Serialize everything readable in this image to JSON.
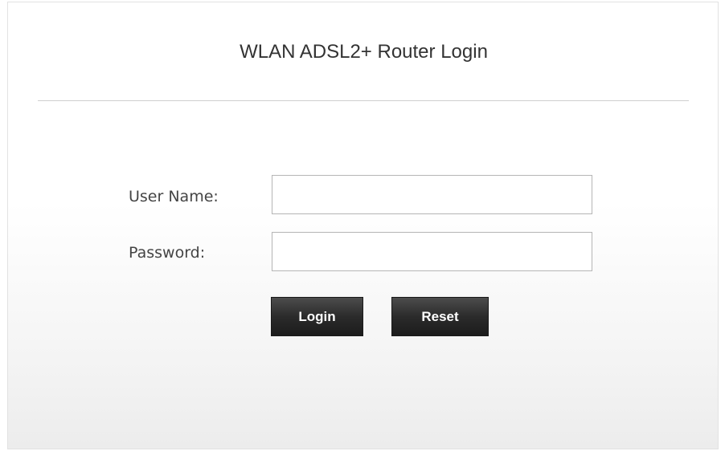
{
  "login_panel": {
    "title": "WLAN ADSL2+ Router Login",
    "username_label": "User Name:",
    "username_value": "",
    "username_placeholder": "",
    "password_label": "Password:",
    "password_value": "",
    "password_placeholder": "",
    "login_button": "Login",
    "reset_button": "Reset"
  },
  "colors": {
    "button_dark": "#2b2b2b",
    "title_text": "#333333",
    "divider": "#cfcfcf"
  }
}
